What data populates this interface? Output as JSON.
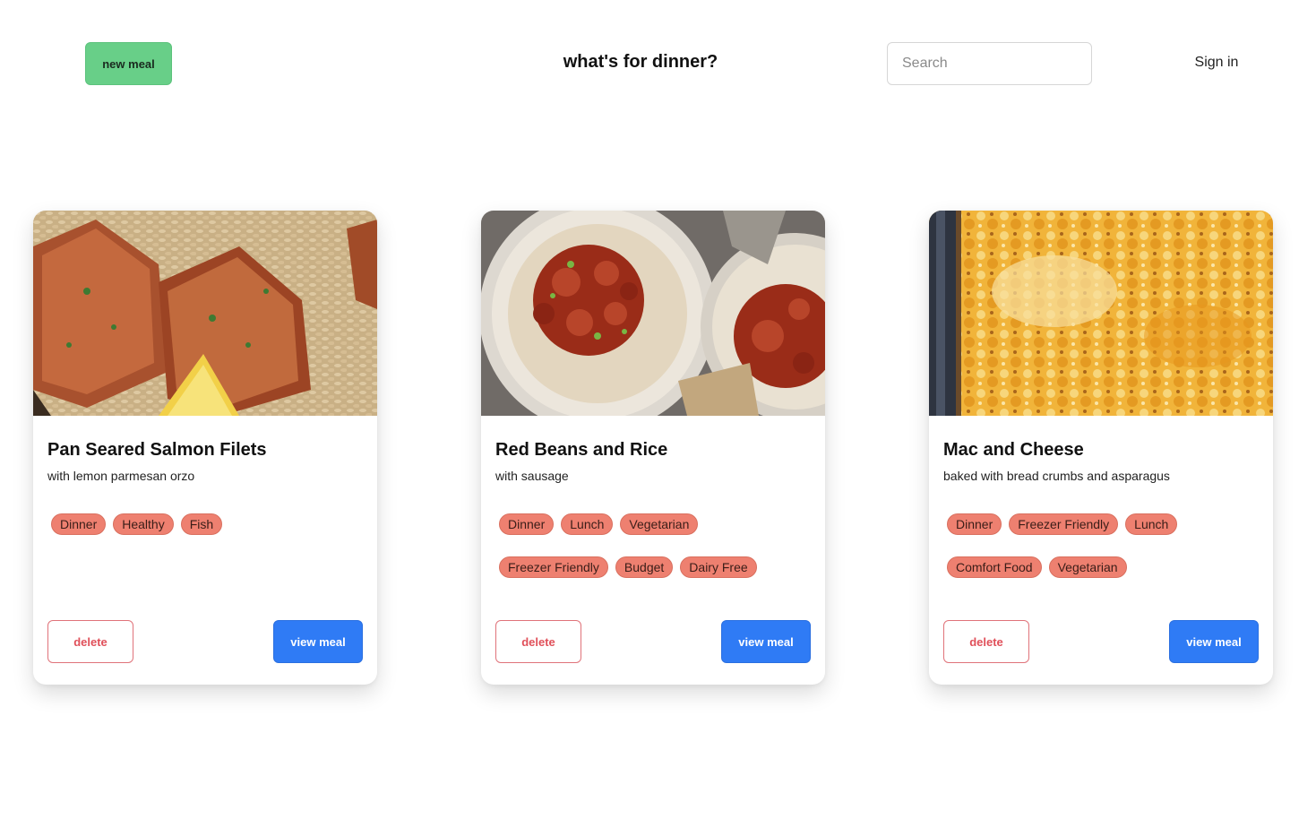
{
  "header": {
    "new_meal_label": "new meal",
    "title": "what's for dinner?",
    "search_placeholder": "Search",
    "search_value": "",
    "sign_in_label": "Sign in"
  },
  "colors": {
    "new_meal_bg": "#68cf88",
    "tag_bg": "#ee8070",
    "delete_accent": "#e0505a",
    "view_bg": "#2f7bf5"
  },
  "meals": [
    {
      "title": "Pan Seared Salmon Filets",
      "subtitle": "with lemon parmesan orzo",
      "image": "salmon-orzo-photo",
      "tags": [
        "Dinner",
        "Healthy",
        "Fish"
      ],
      "delete_label": "delete",
      "view_label": "view meal"
    },
    {
      "title": "Red Beans and Rice",
      "subtitle": "with sausage",
      "image": "red-beans-rice-photo",
      "tags": [
        "Dinner",
        "Lunch",
        "Vegetarian",
        "Freezer Friendly",
        "Budget",
        "Dairy Free"
      ],
      "delete_label": "delete",
      "view_label": "view meal"
    },
    {
      "title": "Mac and Cheese",
      "subtitle": "baked with bread crumbs and asparagus",
      "image": "mac-and-cheese-photo",
      "tags": [
        "Dinner",
        "Freezer Friendly",
        "Lunch",
        "Comfort Food",
        "Vegetarian"
      ],
      "delete_label": "delete",
      "view_label": "view meal"
    }
  ]
}
